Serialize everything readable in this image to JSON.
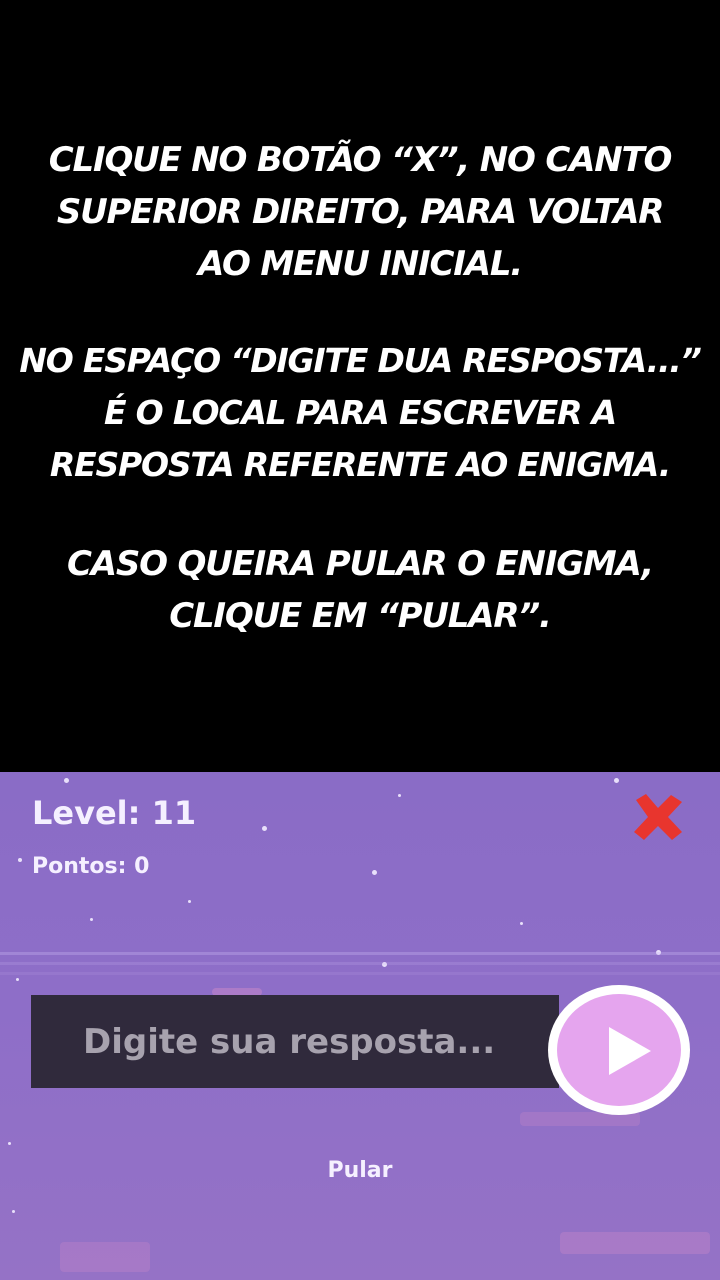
{
  "instructions": {
    "paragraph1": [
      "CLIQUE NO BOTÃO “X”, NO CANTO",
      "SUPERIOR  DIREITO, PARA VOLTAR",
      "AO MENU INICIAL."
    ],
    "paragraph2": [
      "NO ESPAÇO “DIGITE DUA RESPOSTA...”",
      "É O LOCAL PARA ESCREVER A",
      "RESPOSTA REFERENTE AO ENIGMA."
    ],
    "paragraph3": [
      "CASO QUEIRA PULAR O ENIGMA,",
      "CLIQUE EM “PULAR”."
    ]
  },
  "game": {
    "level_text": "Level: 11",
    "points_text": "Pontos: 0",
    "close_icon": "close-x-icon",
    "answer_placeholder": "Digite sua resposta...",
    "submit_icon": "play-icon",
    "skip_label": "Pular"
  },
  "colors": {
    "background_game": "#8e6ec8",
    "close_red": "#e8352e",
    "input_bg": "#302a3c",
    "play_pink": "#e5a5ee"
  }
}
